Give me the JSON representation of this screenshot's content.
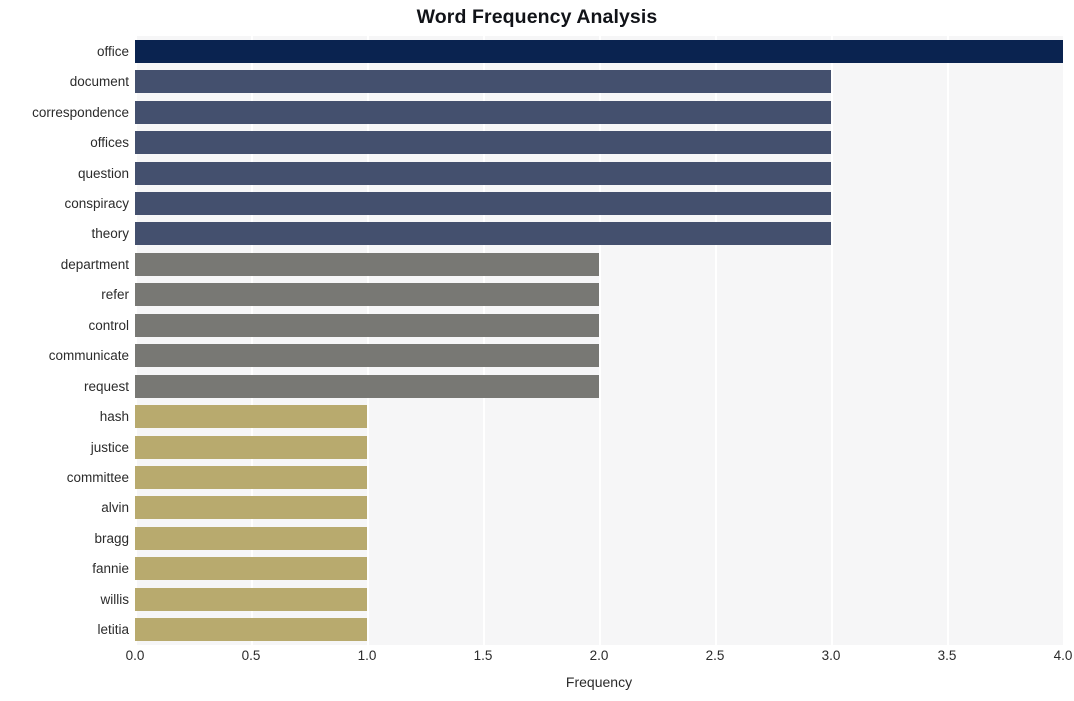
{
  "chart_data": {
    "type": "bar",
    "orientation": "horizontal",
    "title": "Word Frequency Analysis",
    "xlabel": "Frequency",
    "ylabel": "",
    "xlim": [
      0,
      4
    ],
    "ylim": null,
    "grid": true,
    "legend": null,
    "xticks": [
      "0.0",
      "0.5",
      "1.0",
      "1.5",
      "2.0",
      "2.5",
      "3.0",
      "3.5",
      "4.0"
    ],
    "xtick_values": [
      0,
      0.5,
      1,
      1.5,
      2,
      2.5,
      3,
      3.5,
      4
    ],
    "categories": [
      "office",
      "document",
      "correspondence",
      "offices",
      "question",
      "conspiracy",
      "theory",
      "department",
      "refer",
      "control",
      "communicate",
      "request",
      "hash",
      "justice",
      "committee",
      "alvin",
      "bragg",
      "fannie",
      "willis",
      "letitia"
    ],
    "values": [
      4,
      3,
      3,
      3,
      3,
      3,
      3,
      2,
      2,
      2,
      2,
      2,
      1,
      1,
      1,
      1,
      1,
      1,
      1,
      1
    ],
    "bar_colors": [
      "#0a2350",
      "#44506e",
      "#44506e",
      "#44506e",
      "#44506e",
      "#44506e",
      "#44506e",
      "#787874",
      "#787874",
      "#787874",
      "#787874",
      "#787874",
      "#b8aa6e",
      "#b8aa6e",
      "#b8aa6e",
      "#b8aa6e",
      "#b8aa6e",
      "#b8aa6e",
      "#b8aa6e",
      "#b8aa6e"
    ],
    "colors": {
      "plot_background": "#f6f6f7",
      "figure_background": "#ffffff",
      "gridline": "#ffffff",
      "text": "#2b2b2b",
      "title_text": "#111318",
      "value_4": "#0a2350",
      "value_3": "#44506e",
      "value_2": "#787874",
      "value_1": "#b8aa6e"
    }
  }
}
